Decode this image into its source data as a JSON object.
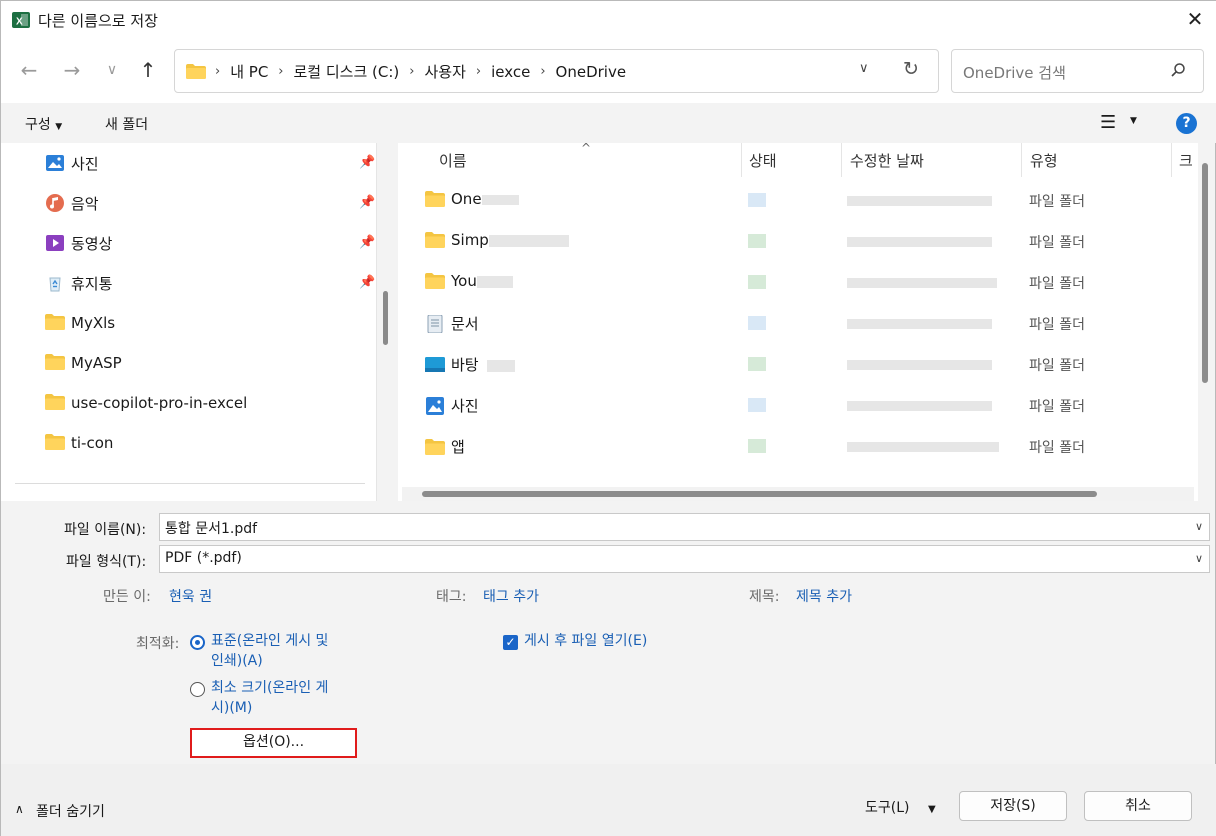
{
  "window": {
    "title": "다른 이름으로 저장",
    "colors": {
      "accent": "#1a65c8",
      "highlight_box": "#e01b1b",
      "excel_green": "#1d6f42"
    }
  },
  "nav": {
    "breadcrumbs": [
      "내 PC",
      "로컬 디스크 (C:)",
      "사용자",
      "iexce",
      "OneDrive"
    ],
    "search_placeholder": "OneDrive 검색"
  },
  "commands": {
    "organize": "구성",
    "new_folder": "새 폴더",
    "help": "?"
  },
  "sidebar": {
    "items": [
      {
        "label": "사진",
        "icon": "pictures-icon",
        "pinned": true
      },
      {
        "label": "음악",
        "icon": "music-icon",
        "pinned": true
      },
      {
        "label": "동영상",
        "icon": "videos-icon",
        "pinned": true
      },
      {
        "label": "휴지통",
        "icon": "recycle-bin-icon",
        "pinned": true
      },
      {
        "label": "MyXls",
        "icon": "folder-icon",
        "pinned": false
      },
      {
        "label": "MyASP",
        "icon": "folder-icon",
        "pinned": false
      },
      {
        "label": "use-copilot-pro-in-excel",
        "icon": "folder-icon",
        "pinned": false
      },
      {
        "label": "ti-con",
        "icon": "folder-icon",
        "pinned": false
      }
    ]
  },
  "file_list": {
    "columns": [
      "이름",
      "상태",
      "수정한 날짜",
      "유형",
      "크"
    ],
    "rows": [
      {
        "name": "One",
        "icon": "folder-icon",
        "type": "파일 폴더"
      },
      {
        "name": "Simp",
        "icon": "folder-icon",
        "type": "파일 폴더"
      },
      {
        "name": "You",
        "icon": "folder-icon",
        "type": "파일 폴더"
      },
      {
        "name": "문서",
        "icon": "documents-icon",
        "type": "파일 폴더"
      },
      {
        "name": "바탕",
        "icon": "desktop-icon",
        "type": "파일 폴더"
      },
      {
        "name": "사진",
        "icon": "pictures-icon",
        "type": "파일 폴더"
      },
      {
        "name": "앱",
        "icon": "folder-icon",
        "type": "파일 폴더"
      }
    ]
  },
  "form": {
    "filename_label": "파일 이름(N):",
    "filename_value": "통합 문서1.pdf",
    "filetype_label": "파일 형식(T):",
    "filetype_value": "PDF (*.pdf)",
    "author_label": "만든 이:",
    "author_value": "현욱 권",
    "tags_label": "태그:",
    "tags_value": "태그 추가",
    "title_label": "제목:",
    "title_value": "제목 추가",
    "optimize_label": "최적화:",
    "optimize_standard_line1": "표준(온라인 게시 및",
    "optimize_standard_line2": "인쇄)(A)",
    "optimize_minimum_line1": "최소 크기(온라인 게",
    "optimize_minimum_line2": "시)(M)",
    "open_after_publish": "게시 후 파일 열기(E)",
    "options_button": "옵션(O)..."
  },
  "footer": {
    "hide_folders": "폴더 숨기기",
    "tools": "도구(L)",
    "save": "저장(S)",
    "cancel": "취소"
  }
}
